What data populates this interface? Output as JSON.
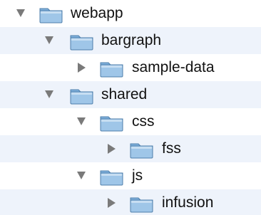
{
  "tree": {
    "items": [
      {
        "label": "webapp",
        "expanded": true,
        "icon": "folder-icon",
        "toggle": "triangle-down-icon"
      },
      {
        "label": "bargraph",
        "expanded": true,
        "icon": "folder-icon",
        "toggle": "triangle-down-icon"
      },
      {
        "label": "sample-data",
        "expanded": false,
        "icon": "folder-icon",
        "toggle": "triangle-right-icon"
      },
      {
        "label": "shared",
        "expanded": true,
        "icon": "folder-icon",
        "toggle": "triangle-down-icon"
      },
      {
        "label": "css",
        "expanded": true,
        "icon": "folder-icon",
        "toggle": "triangle-down-icon"
      },
      {
        "label": "fss",
        "expanded": false,
        "icon": "folder-icon",
        "toggle": "triangle-right-icon"
      },
      {
        "label": "js",
        "expanded": true,
        "icon": "folder-icon",
        "toggle": "triangle-down-icon"
      },
      {
        "label": "infusion",
        "expanded": false,
        "icon": "folder-icon",
        "toggle": "triangle-right-icon"
      }
    ]
  },
  "colors": {
    "alt_row": "#eef3fb",
    "folder_body": "#9fc6e8",
    "folder_tab": "#7fb0dc",
    "folder_edge": "#4f7fab",
    "triangle": "#7a7a7a",
    "text": "#111111"
  }
}
